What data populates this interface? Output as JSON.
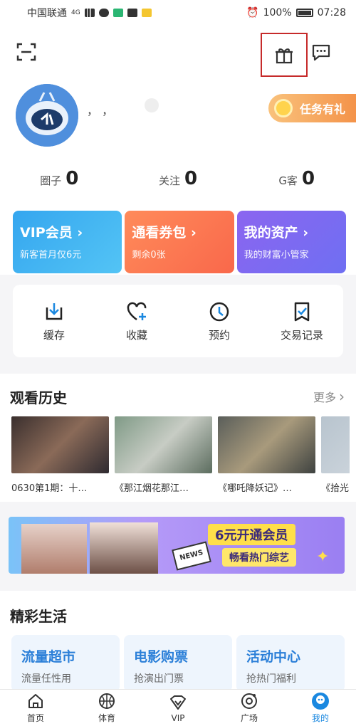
{
  "statusbar": {
    "carrier": "中国联通",
    "network": "4G",
    "battery": "100%",
    "time": "07:28"
  },
  "header": {
    "username": "，  ，",
    "task_label": "任务有礼"
  },
  "stats": [
    {
      "label": "圈子",
      "value": "0"
    },
    {
      "label": "关注",
      "value": "0"
    },
    {
      "label": "G客",
      "value": "0"
    }
  ],
  "cards": [
    {
      "title": "VIP会员 ›",
      "sub": "新客首月仅6元"
    },
    {
      "title": "通看券包 ›",
      "sub": "剩余0张"
    },
    {
      "title": "我的资产 ›",
      "sub": "我的财富小管家"
    }
  ],
  "quick": [
    {
      "label": "缓存",
      "icon": "download-icon"
    },
    {
      "label": "收藏",
      "icon": "heart-plus-icon"
    },
    {
      "label": "预约",
      "icon": "clock-icon"
    },
    {
      "label": "交易记录",
      "icon": "receipt-check-icon"
    }
  ],
  "history": {
    "title": "观看历史",
    "more": "更多",
    "items": [
      {
        "caption": "0630第1期：十…",
        "color": "#5b4a48"
      },
      {
        "caption": "《那江烟花那江…",
        "color": "#8fa592"
      },
      {
        "caption": "《哪吒降妖记》…",
        "color": "#6b6f6a"
      },
      {
        "caption": "《拾光的",
        "color": "#a8b5c0"
      }
    ]
  },
  "banner": {
    "badge": "NEWS",
    "title": "6元开通会员",
    "sub": "畅看热门综艺"
  },
  "life": {
    "title": "精彩生活",
    "items": [
      {
        "title": "流量超市",
        "sub": "流量任性用"
      },
      {
        "title": "电影购票",
        "sub": "抢演出门票"
      },
      {
        "title": "活动中心",
        "sub": "抢热门福利"
      }
    ]
  },
  "tabs": [
    {
      "label": "首页",
      "icon": "home-icon"
    },
    {
      "label": "体育",
      "icon": "basketball-icon"
    },
    {
      "label": "VIP",
      "icon": "vip-crown-icon"
    },
    {
      "label": "广场",
      "icon": "square-icon"
    },
    {
      "label": "我的",
      "icon": "profile-icon"
    }
  ],
  "colors": {
    "accent": "#1a88e0",
    "highlight_box": "#c62a2a"
  }
}
